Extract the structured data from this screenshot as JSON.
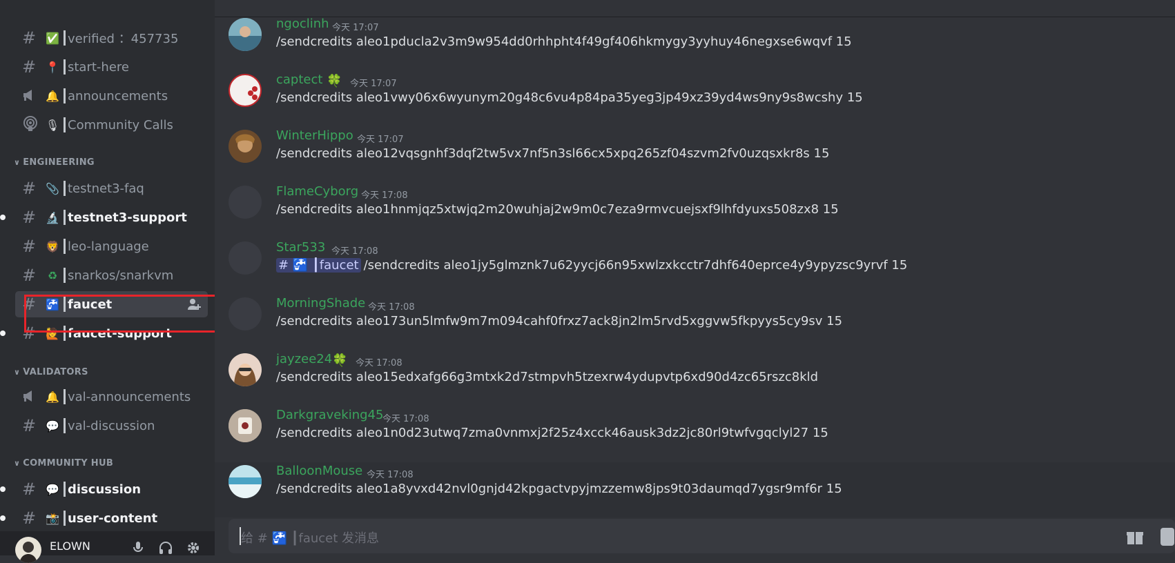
{
  "sidebar": {
    "channels_top": [
      {
        "label": "verified ：457735",
        "emoji": "✅",
        "kind": "hash"
      },
      {
        "label": "start-here",
        "emoji": "📍",
        "kind": "hash"
      },
      {
        "label": "announcements",
        "emoji": "🔔",
        "kind": "announce"
      },
      {
        "label": "Community Calls",
        "emoji": "🎙",
        "kind": "stage"
      }
    ],
    "categories": {
      "engineering": "ENGINEERING",
      "validators": "VALIDATORS",
      "community_hub": "COMMUNITY HUB"
    },
    "engineering_channels": [
      {
        "label": "testnet3-faq",
        "emoji": "📎",
        "unread": false
      },
      {
        "label": "testnet3-support",
        "emoji": "🔬",
        "unread": true
      },
      {
        "label": "leo-language",
        "emoji": "🦁",
        "unread": false
      },
      {
        "label": "snarkos∕snarkvm",
        "emoji": "♻",
        "unread": false
      },
      {
        "label": "faucet",
        "emoji": "🚰",
        "active": true
      },
      {
        "label": "faucet-support",
        "emoji": "🙋",
        "unread": true
      }
    ],
    "validators_channels": [
      {
        "label": "val-announcements",
        "emoji": "🔔"
      },
      {
        "label": "val-discussion",
        "emoji": "💬"
      }
    ],
    "community_channels": [
      {
        "label": "discussion",
        "emoji": "💬",
        "unread": true
      },
      {
        "label": "user-content",
        "emoji": "📸",
        "unread": true
      }
    ]
  },
  "user": {
    "name": "ELOWN"
  },
  "messages": [
    {
      "author": "ngoclinh",
      "time": "今天 17:07",
      "text": "/sendcredits aleo1pducla2v3m9w954dd0rhhpht4f49gf406hkmygy3yyhuy46negxse6wqvf 15",
      "badge": ""
    },
    {
      "author": "captect",
      "time": "今天 17:07",
      "text": "/sendcredits aleo1vwy06x6wyunym20g48c6vu4p84pa35yeg3jp49xz39yd4ws9ny9s8wcshy 15",
      "badge": "🍀"
    },
    {
      "author": "WinterHippo",
      "time": "今天 17:07",
      "text": "/sendcredits aleo12vqsgnhf3dqf2tw5vx7nf5n3sl66cx5xpq265zf04szvm2fv0uzqsxkr8s 15",
      "badge": ""
    },
    {
      "author": "FlameCyborg",
      "time": "今天 17:08",
      "text": "/sendcredits aleo1hnmjqz5xtwjq2m20wuhjaj2w9m0c7eza9rmvcuejsxf9lhfdyuxs508zx8 15",
      "badge": ""
    },
    {
      "author": "Star533",
      "time": "今天 17:08",
      "mention": "# 🚰 ┃faucet",
      "text": "/sendcredits aleo1jy5glmznk7u62yycj66n95xwlzxkcctr7dhf640eprce4y9ypyzsc9yrvf  15",
      "badge": ""
    },
    {
      "author": "MorningShade",
      "time": "今天 17:08",
      "text": "/sendcredits aleo173un5lmfw9m7m094cahf0frxz7ack8jn2lm5rvd5xggvw5fkpyys5cy9sv 15",
      "badge": ""
    },
    {
      "author": "jayzee24",
      "time": "今天 17:08",
      "text": "/sendcredits aleo15edxafg66g3mtxk2d7stmpvh5tzexrw4ydupvtp6xd90d4zc65rszc8kld",
      "badge": "🍀"
    },
    {
      "author": "Darkgraveking45",
      "time": "今天 17:08",
      "text": "/sendcredits aleo1n0d23utwq7zma0vnmxj2f25z4xcck46ausk3dz2jc80rl9twfvgqclyl27 15",
      "badge": ""
    },
    {
      "author": "BalloonMouse",
      "time": "今天 17:08",
      "text": "/sendcredits aleo1a8yvxd42nvl0gnjd42kpgactvpyjmzzemw8jps9t03daumqd7ygsr9mf6r 15",
      "badge": ""
    }
  ],
  "composer": {
    "placeholder": "给 # 🚰 ┃faucet 发消息"
  }
}
